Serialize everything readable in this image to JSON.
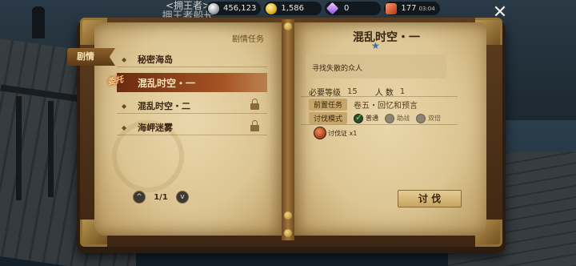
{
  "overlay": {
    "title_line1": "<拥王者>",
    "title_line2": "拥王者船长"
  },
  "resources": [
    {
      "icon": "silver-coin-icon",
      "value": "456,123"
    },
    {
      "icon": "gold-coin-icon",
      "value": "1,586"
    },
    {
      "icon": "gem-icon",
      "value": "0"
    },
    {
      "icon": "stamina-icon",
      "value": "177",
      "sub": "03:04"
    }
  ],
  "close_label": "✕",
  "left_page": {
    "section_header": "剧情任务",
    "tab_label": "剧情",
    "quests": [
      {
        "name": "秘密海岛",
        "locked": false,
        "active": false
      },
      {
        "name": "混乱时空・一",
        "locked": false,
        "active": true,
        "seal": "委托"
      },
      {
        "name": "混乱时空・二",
        "locked": true,
        "active": false
      },
      {
        "name": "海岬迷雾",
        "locked": true,
        "active": false
      }
    ],
    "pager": {
      "prev": "^",
      "text": "1/1",
      "next": "v"
    }
  },
  "right_page": {
    "title": "混乱时空・一",
    "star": "★",
    "description": "寻找失散的众人",
    "level_label": "必要等级",
    "level_value": "15",
    "count_label": "人 数",
    "count_value": "1",
    "prereq_label": "前置任务",
    "prereq_value": "卷五・回忆和预言",
    "mode_label": "讨伐模式",
    "modes": [
      {
        "label": "普通",
        "selected": true
      },
      {
        "label": "助战",
        "selected": false
      },
      {
        "label": "双倍",
        "selected": false
      }
    ],
    "reward_label": "讨伐证 x1",
    "action_button": "讨 伐"
  }
}
